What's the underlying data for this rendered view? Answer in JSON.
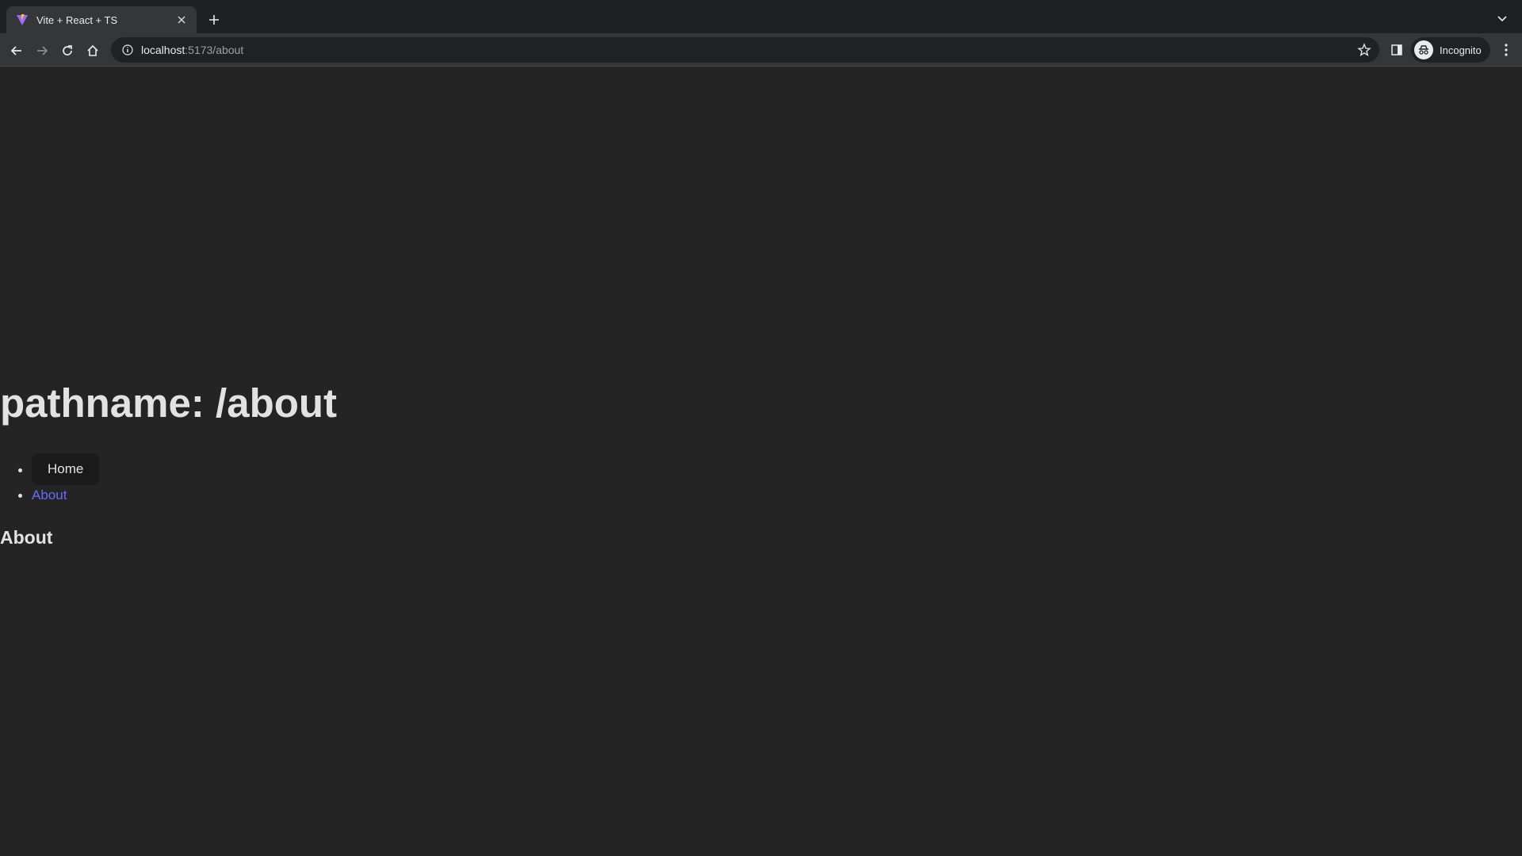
{
  "browser": {
    "tab": {
      "title": "Vite + React + TS"
    },
    "omnibox": {
      "host": "localhost",
      "rest": ":5173/about"
    },
    "profile": {
      "label": "Incognito"
    }
  },
  "page": {
    "heading": "pathname: /about",
    "nav": [
      {
        "label": "Home"
      },
      {
        "label": "About"
      }
    ],
    "section_title": "About"
  },
  "colors": {
    "link": "#646cff",
    "background": "#242424"
  }
}
